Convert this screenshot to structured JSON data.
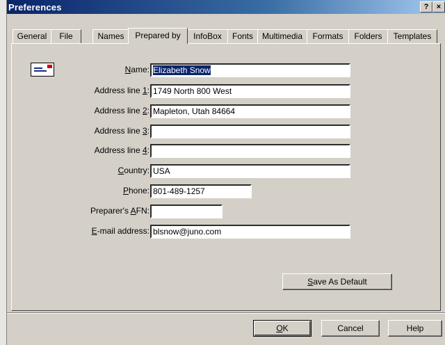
{
  "window": {
    "title": "Preferences",
    "help_glyph": "?",
    "close_glyph": "×"
  },
  "tabs": [
    {
      "label": "General"
    },
    {
      "label": "File"
    },
    {
      "label": "Names"
    },
    {
      "label": "Prepared by"
    },
    {
      "label": "InfoBox"
    },
    {
      "label": "Fonts"
    },
    {
      "label": "Multimedia"
    },
    {
      "label": "Formats"
    },
    {
      "label": "Folders"
    },
    {
      "label": "Templates"
    }
  ],
  "active_tab": "Prepared by",
  "icon": "business-card-icon",
  "form": {
    "name": {
      "pre": "",
      "key": "N",
      "post": "ame:",
      "value": "Elizabeth Snow"
    },
    "address1": {
      "pre": "Address line ",
      "key": "1",
      "post": ":",
      "value": "1749 North 800 West"
    },
    "address2": {
      "pre": "Address line ",
      "key": "2",
      "post": ":",
      "value": "Mapleton, Utah 84664"
    },
    "address3": {
      "pre": "Address line ",
      "key": "3",
      "post": ":",
      "value": ""
    },
    "address4": {
      "pre": "Address line ",
      "key": "4",
      "post": ":",
      "value": ""
    },
    "country": {
      "pre": "",
      "key": "C",
      "post": "ountry:",
      "value": "USA"
    },
    "phone": {
      "pre": "",
      "key": "P",
      "post": "hone:",
      "value": "801-489-1257"
    },
    "afn": {
      "pre": "Preparer's ",
      "key": "A",
      "post": "FN:",
      "value": ""
    },
    "email": {
      "pre": "",
      "key": "E",
      "post": "-mail address:",
      "value": "blsnow@juno.com"
    }
  },
  "buttons": {
    "save_default": {
      "key": "S",
      "rest": "ave As Default"
    },
    "ok": {
      "key": "O",
      "rest": "K"
    },
    "cancel": "Cancel",
    "help": "Help"
  },
  "colors": {
    "title_start": "#0a246a",
    "title_end": "#a6caf0",
    "dialog_face": "#d4d0c8",
    "selection": "#0a246a"
  }
}
